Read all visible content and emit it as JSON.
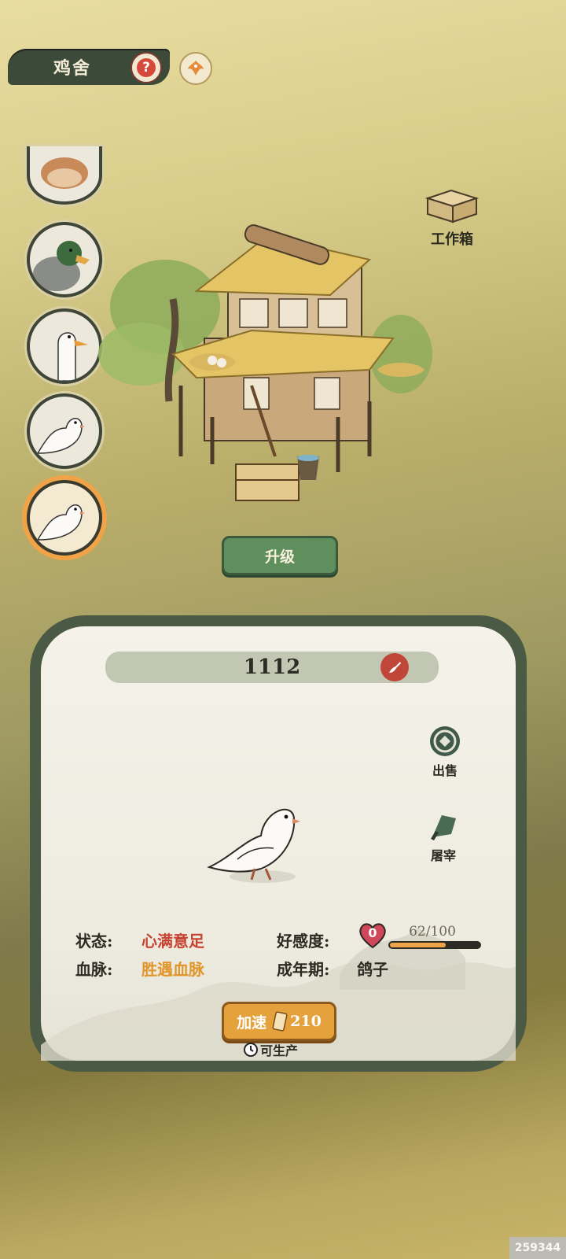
{
  "header": {
    "title": "鸡舍",
    "help_icon": "question-icon",
    "phoenix_icon": "phoenix-icon"
  },
  "animal_list": [
    {
      "kind": "rooster",
      "active": false
    },
    {
      "kind": "mallard-duck",
      "active": false
    },
    {
      "kind": "goose",
      "active": false
    },
    {
      "kind": "pigeon",
      "active": false
    },
    {
      "kind": "pigeon",
      "active": true
    }
  ],
  "workbox": {
    "label": "工作箱"
  },
  "upgrade": {
    "label": "升级"
  },
  "panel": {
    "name": "1112",
    "actions": {
      "sell": "出售",
      "slaughter": "屠宰"
    },
    "status_label": "状态:",
    "status_value": "心满意足",
    "bloodline_label": "血脉:",
    "bloodline_value": "胜遇血脉",
    "affection_label": "好感度:",
    "affection_level": "0",
    "affection_progress": "62/100",
    "affection_fraction": 0.62,
    "adulthood_label": "成年期:",
    "adulthood_value": "鸽子",
    "speed_label": "加速",
    "speed_cost": "210",
    "produce_label": "可生产"
  },
  "colors": {
    "accent_orange": "#f0a447",
    "status_red": "#c8432f",
    "bloodline_orange": "#e0952a",
    "button_green": "#5e8f5d"
  },
  "watermark": "259344"
}
